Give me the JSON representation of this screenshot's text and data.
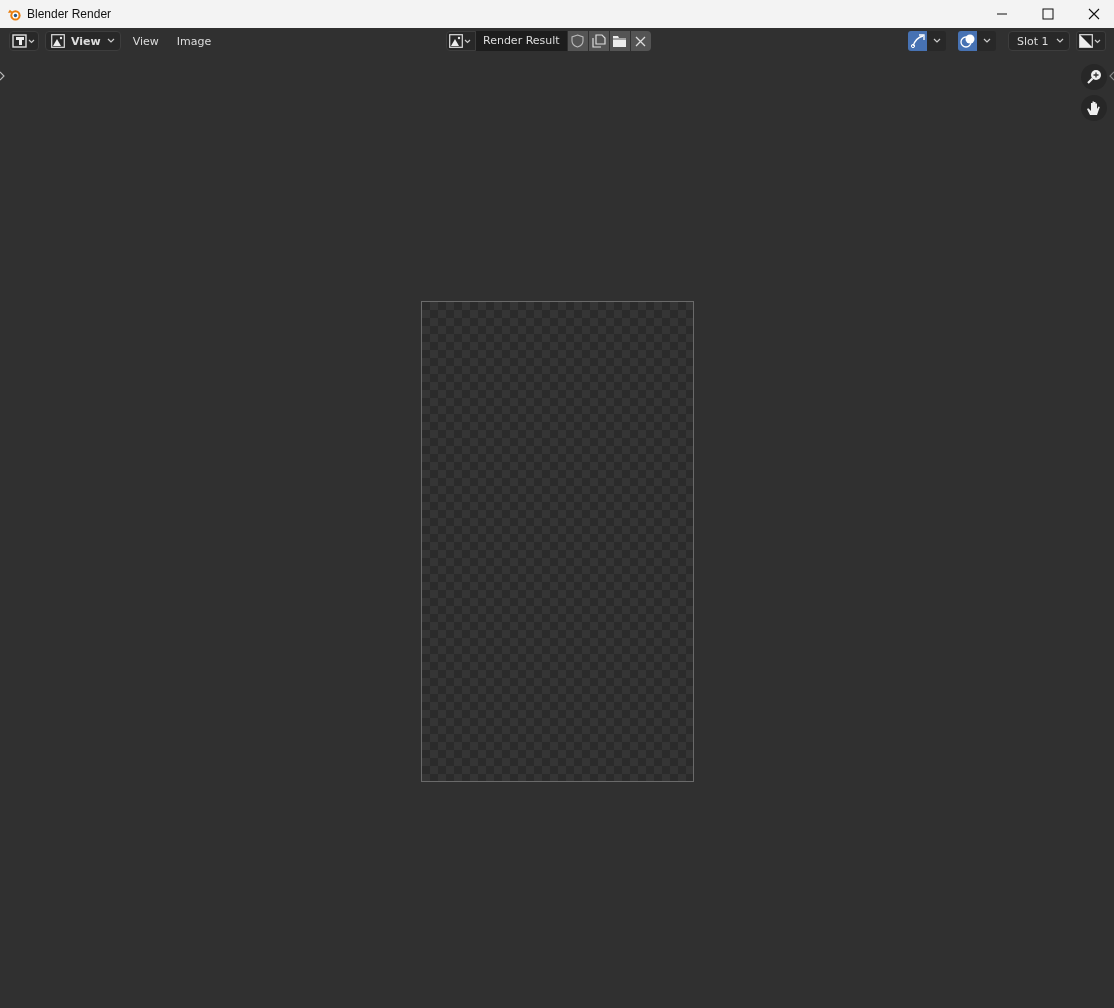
{
  "window": {
    "title": "Blender Render"
  },
  "header": {
    "view_dropdown": "View",
    "menus": [
      "View",
      "Image"
    ],
    "image_name": "Render Result",
    "fake_user": false,
    "toggles": [
      {
        "kind": "gizmo",
        "on": true
      },
      {
        "kind": "overlay",
        "on": true
      }
    ],
    "slot": "Slot 1"
  }
}
